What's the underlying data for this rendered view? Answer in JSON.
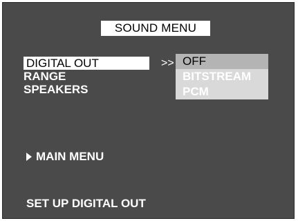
{
  "title": "SOUND MENU",
  "menu": {
    "items": [
      {
        "label": "DIGITAL OUT",
        "selected": true
      },
      {
        "label": "RANGE",
        "selected": false
      },
      {
        "label": "SPEAKERS",
        "selected": false
      }
    ]
  },
  "submenu_arrow": ">>",
  "options": [
    {
      "label": "OFF",
      "active": true
    },
    {
      "label": "BITSTREAM",
      "active": false
    },
    {
      "label": "PCM",
      "active": false
    }
  ],
  "main_menu_label": "MAIN MENU",
  "footer_text": "SET UP DIGITAL OUT",
  "colors": {
    "screen_bg": "#4a4a4a",
    "highlight_bg": "#ffffff",
    "option_active_bg": "#b4b4b4",
    "option_inactive_bg": "#d9d9d9"
  }
}
